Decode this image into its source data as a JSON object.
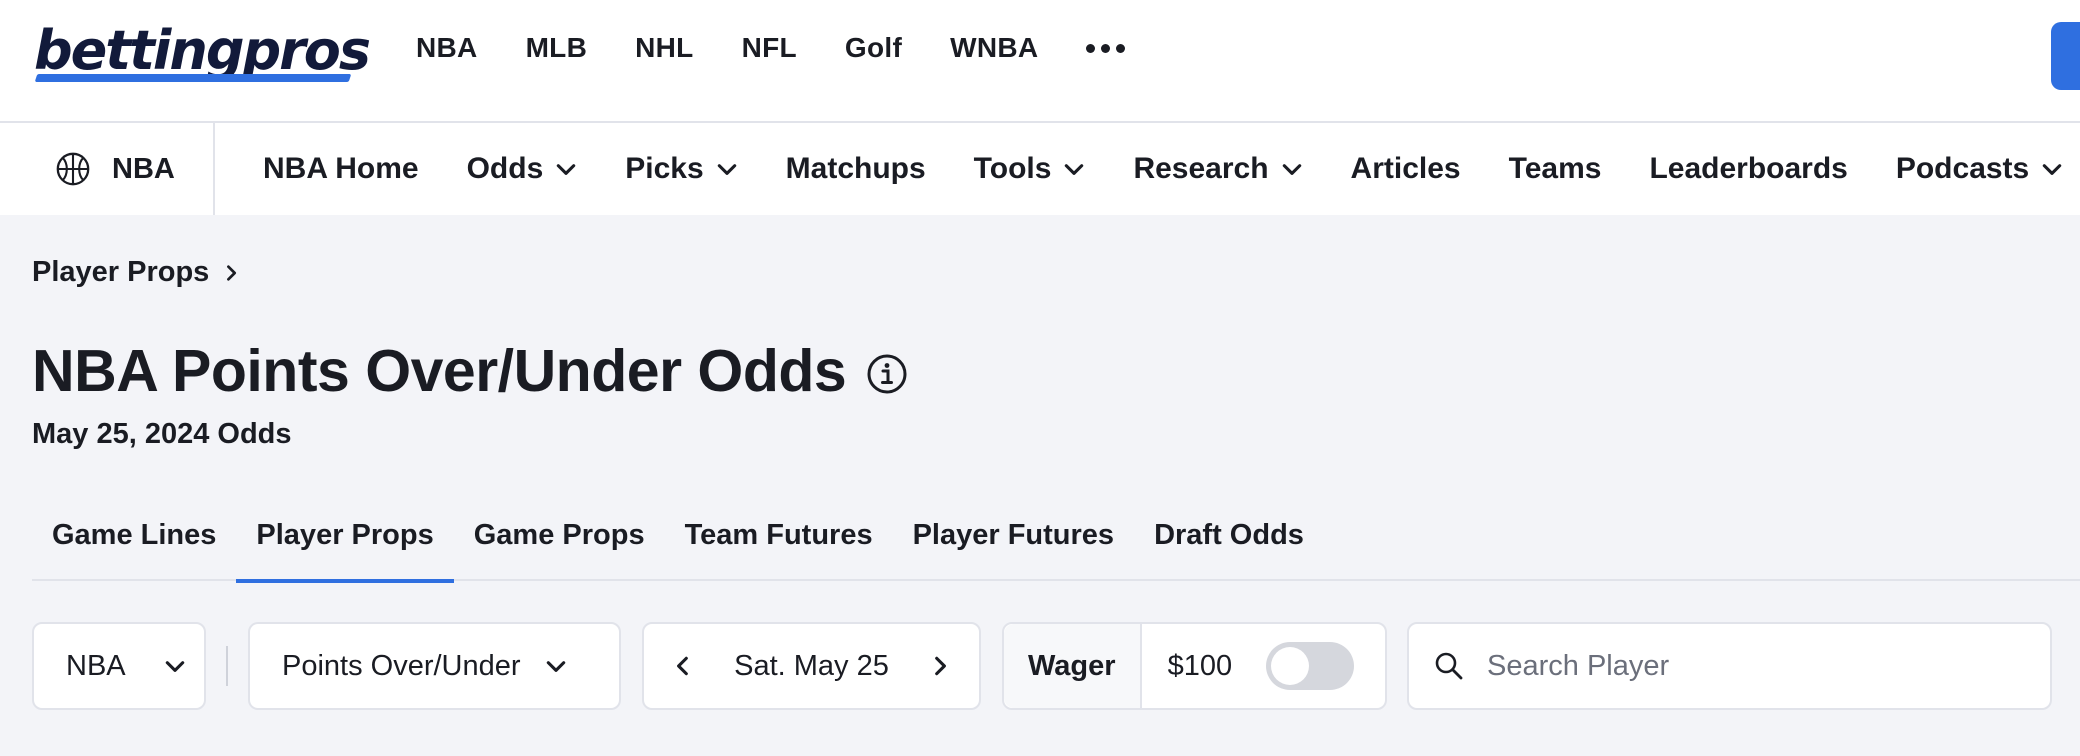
{
  "brand": {
    "logo_text": "bettingpros",
    "accent_color": "#2f6fe0"
  },
  "top_nav": {
    "sports": [
      "NBA",
      "MLB",
      "NHL",
      "NFL",
      "Golf",
      "WNBA"
    ],
    "more_icon": "more-dots-icon"
  },
  "sub_nav": {
    "league_label": "NBA",
    "league_icon": "basketball-icon",
    "items": [
      {
        "label": "NBA Home",
        "has_dropdown": false
      },
      {
        "label": "Odds",
        "has_dropdown": true
      },
      {
        "label": "Picks",
        "has_dropdown": true
      },
      {
        "label": "Matchups",
        "has_dropdown": false
      },
      {
        "label": "Tools",
        "has_dropdown": true
      },
      {
        "label": "Research",
        "has_dropdown": true
      },
      {
        "label": "Articles",
        "has_dropdown": false
      },
      {
        "label": "Teams",
        "has_dropdown": false
      },
      {
        "label": "Leaderboards",
        "has_dropdown": false
      },
      {
        "label": "Podcasts",
        "has_dropdown": true
      }
    ]
  },
  "breadcrumb": {
    "label": "Player Props"
  },
  "page": {
    "title": "NBA Points Over/Under Odds",
    "subtitle": "May 25, 2024 Odds"
  },
  "tabs": [
    {
      "label": "Game Lines",
      "active": false
    },
    {
      "label": "Player Props",
      "active": true
    },
    {
      "label": "Game Props",
      "active": false
    },
    {
      "label": "Team Futures",
      "active": false
    },
    {
      "label": "Player Futures",
      "active": false
    },
    {
      "label": "Draft Odds",
      "active": false
    }
  ],
  "filters": {
    "league_select": "NBA",
    "market_select": "Points Over/Under",
    "date": "Sat. May 25",
    "wager_label": "Wager",
    "wager_amount": "$100",
    "wager_toggle_on": false,
    "search_placeholder": "Search Player"
  }
}
